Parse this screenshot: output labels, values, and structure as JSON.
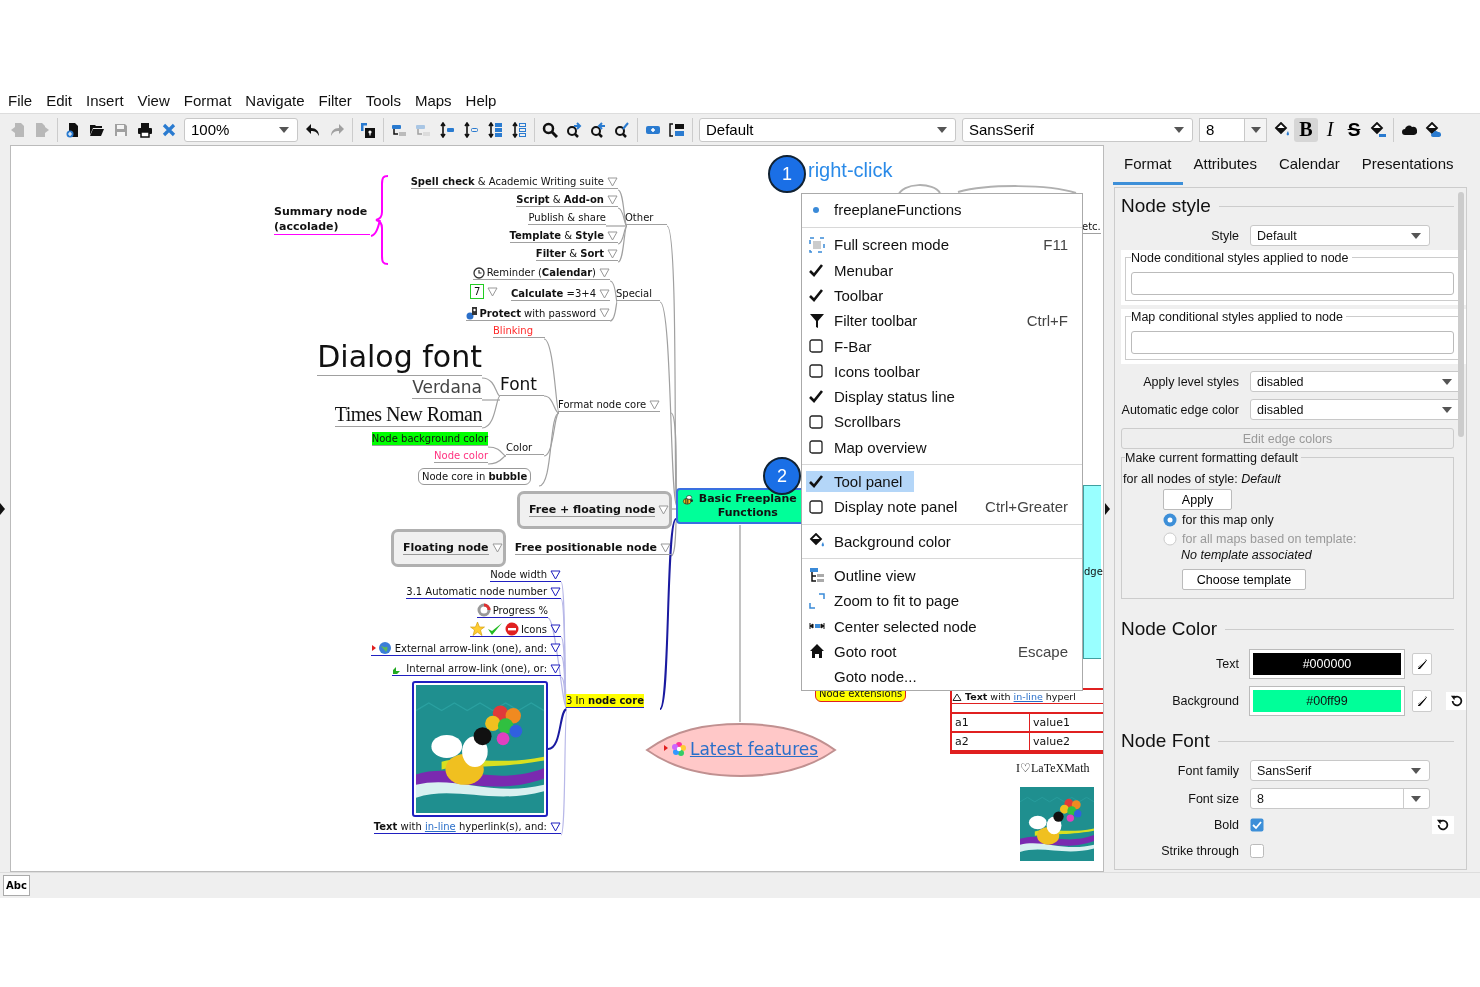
{
  "menubar": [
    "File",
    "Edit",
    "Insert",
    "View",
    "Format",
    "Navigate",
    "Filter",
    "Tools",
    "Maps",
    "Help"
  ],
  "toolbar": {
    "buttons": [
      {
        "disabled": true
      },
      {
        "disabled": true
      },
      {
        "disabled": false
      },
      {
        "disabled": false
      },
      {
        "disabled": true
      },
      {
        "disabled": false
      },
      {
        "disabled": false
      },
      {
        "disabled": false
      },
      {
        "disabled": true
      },
      {
        "disabled": false
      },
      {
        "disabled": false
      },
      {
        "disabled": true
      },
      {
        "disabled": false
      },
      {
        "disabled": false
      },
      {
        "disabled": false
      },
      {
        "disabled": false
      },
      {
        "disabled": false
      },
      {
        "disabled": false
      },
      {
        "disabled": false
      },
      {
        "disabled": false
      },
      {
        "disabled": false
      },
      {
        "disabled": false
      }
    ],
    "zoom": "100%",
    "style": "Default",
    "font_family": "SansSerif",
    "font_size": "8",
    "format_buttons": [
      {
        "pressed": false
      },
      {
        "label": "B",
        "pressed": true
      },
      {
        "label": "I",
        "pressed": false
      },
      {
        "label": "S",
        "pressed": false
      },
      {
        "pressed": false
      },
      {
        "pressed": false
      },
      {
        "pressed": false
      }
    ]
  },
  "map": {
    "nodes": [
      {
        "kind": "fork",
        "text": "Summary node (accolade)",
        "folded": false
      },
      {
        "kind": "fork",
        "text": "**Spell check** & Academic Writing suite",
        "folded": true
      },
      {
        "kind": "fork",
        "text": "**Script** & **Add-on**",
        "folded": true
      },
      {
        "kind": "fork",
        "text": "Publish & share",
        "folded": false
      },
      {
        "kind": "fork",
        "text": "**Template** & **Style**",
        "folded": true
      },
      {
        "kind": "fork",
        "text": "**Filter** & **Sort**",
        "folded": true
      },
      {
        "kind": "fork",
        "text": "Other",
        "folded": false
      },
      {
        "kind": "fork",
        "text": "Reminder (**Calendar**)",
        "folded": true
      },
      {
        "kind": "number",
        "text": "7",
        "folded": true
      },
      {
        "kind": "fork",
        "text": "**Calculate** =3+4",
        "folded": true
      },
      {
        "kind": "fork",
        "text": "**Protect** with password",
        "folded": true
      },
      {
        "kind": "fork",
        "text": "Special",
        "folded": false
      },
      {
        "kind": "fork",
        "text": "Blinking",
        "color": "#ff2a2a",
        "folded": false
      },
      {
        "kind": "fork",
        "text": "Dialog font",
        "folded": false
      },
      {
        "kind": "fork",
        "text": "Verdana",
        "folded": false
      },
      {
        "kind": "fork",
        "text": "Times New Roman",
        "folded": false
      },
      {
        "kind": "fork",
        "text": "Font",
        "folded": false
      },
      {
        "kind": "highlight",
        "text": "Node background color",
        "color": "#00ff00",
        "folded": false
      },
      {
        "kind": "fork",
        "text": "Node color",
        "color": "#ff3380",
        "folded": false
      },
      {
        "kind": "fork",
        "text": "Color",
        "folded": false
      },
      {
        "kind": "bubble",
        "text": "Node core in **bubble**",
        "folded": false
      },
      {
        "kind": "fork",
        "text": "Format node core",
        "folded": true
      },
      {
        "kind": "floating",
        "text": "Free + floating node",
        "folded": true
      },
      {
        "kind": "floating",
        "text": "Floating node",
        "folded": true
      },
      {
        "kind": "fork",
        "text": "Free positionable node",
        "folded": true
      },
      {
        "kind": "fork",
        "text": "Node width",
        "folded": true
      },
      {
        "kind": "fork",
        "text": "3.1 Automatic node number",
        "folded": true
      },
      {
        "kind": "fork",
        "text": "Progress %",
        "folded": false
      },
      {
        "kind": "fork",
        "text": "Icons",
        "folded": true
      },
      {
        "kind": "fork",
        "text": "External arrow-link (one), and:",
        "folded": true
      },
      {
        "kind": "fork",
        "text": "Internal arrow-link (one), or:",
        "folded": true
      },
      {
        "kind": "picture"
      },
      {
        "kind": "link-text",
        "text_before": "**Text**  with ",
        "link": "in-line",
        "text_after": " hyperlink(s), and:",
        "folded": true
      },
      {
        "kind": "highlight",
        "text": "3 In **node core**",
        "color": "#ffff00",
        "folded": false
      },
      {
        "kind": "root",
        "text": "Basic Freeplane Functions",
        "color": "#00ff99"
      },
      {
        "kind": "cloud",
        "text": "Latest features",
        "color": "#ffc8c8"
      },
      {
        "kind": "fork",
        "text": "etc.",
        "folded": false
      },
      {
        "kind": "box",
        "text": "dge",
        "color": "#99ffff"
      },
      {
        "kind": "bubble",
        "text": "Node extensions",
        "color": "#ffff00",
        "folded": false
      },
      {
        "kind": "table",
        "text_before": "**Text**  with ",
        "link": "in-line",
        "text_after": " hyperl",
        "rows": [
          [
            "a1",
            "value1"
          ],
          [
            "a2",
            "value2"
          ]
        ]
      },
      {
        "kind": "latex",
        "text": "I♡LaTeXMath"
      },
      {
        "kind": "picture"
      }
    ]
  },
  "callouts": [
    {
      "number": "1",
      "label": "right-click"
    },
    {
      "number": "2"
    }
  ],
  "context_menu": {
    "groups": [
      {
        "items": [
          {
            "kind": "bullet",
            "label": "freeplaneFunctions",
            "selected": false
          }
        ]
      },
      {
        "items": [
          {
            "kind": "icon",
            "label": "Full screen mode",
            "shortcut": "F11",
            "selected": false
          },
          {
            "kind": "check",
            "label": "Menubar",
            "checked": true,
            "selected": false
          },
          {
            "kind": "check",
            "label": "Toolbar",
            "checked": true,
            "selected": false
          },
          {
            "kind": "icon",
            "label": "Filter toolbar",
            "shortcut": "Ctrl+F",
            "selected": false
          },
          {
            "kind": "check",
            "label": "F-Bar",
            "checked": false,
            "selected": false
          },
          {
            "kind": "check",
            "label": "Icons toolbar",
            "checked": false,
            "selected": false
          },
          {
            "kind": "check",
            "label": "Display status line",
            "checked": true,
            "selected": false
          },
          {
            "kind": "check",
            "label": "Scrollbars",
            "checked": false,
            "selected": false
          },
          {
            "kind": "check",
            "label": "Map overview",
            "checked": false,
            "selected": false
          }
        ]
      },
      {
        "items": [
          {
            "kind": "check",
            "label": "Tool panel",
            "checked": true,
            "selected": true
          },
          {
            "kind": "check",
            "label": "Display note panel",
            "checked": false,
            "shortcut": "Ctrl+Greater",
            "selected": false
          }
        ]
      },
      {
        "items": [
          {
            "kind": "icon",
            "label": "Background color",
            "selected": false
          }
        ]
      },
      {
        "items": [
          {
            "kind": "icon",
            "label": "Outline view",
            "selected": false
          },
          {
            "kind": "icon",
            "label": "Zoom to fit to page",
            "selected": false
          },
          {
            "kind": "icon",
            "label": "Center selected node",
            "selected": false
          },
          {
            "kind": "icon",
            "label": "Goto root",
            "shortcut": "Escape",
            "selected": false
          },
          {
            "kind": "plain",
            "label": "Goto node...",
            "selected": false
          }
        ]
      }
    ]
  },
  "tool_panel": {
    "tabs": [
      {
        "label": "Format",
        "selected": true
      },
      {
        "label": "Attributes",
        "selected": false
      },
      {
        "label": "Calendar",
        "selected": false
      },
      {
        "label": "Presentations",
        "selected": false
      }
    ],
    "sections": [
      {
        "title": "Node style",
        "rows": [
          {
            "kind": "combo",
            "label": "Style",
            "value": "Default"
          },
          {
            "kind": "condition-group",
            "legend": "Node conditional styles applied to node"
          },
          {
            "kind": "condition-group",
            "legend": "Map conditional styles applied to node"
          },
          {
            "kind": "wide-combo",
            "label": "Apply level styles",
            "value": "disabled"
          },
          {
            "kind": "wide-combo",
            "label": "Automatic edge color",
            "value": "disabled"
          },
          {
            "kind": "wide-button",
            "label": "Edit edge colors",
            "disabled": true
          },
          {
            "kind": "default-group",
            "legend": "Make current formatting default",
            "text": "for all nodes of style: *Default*",
            "apply": "Apply",
            "radios": [
              {
                "label": "for this map only",
                "selected": true,
                "disabled": false
              },
              {
                "label": "for all maps based on template:",
                "selected": false,
                "disabled": true
              }
            ],
            "note": "No template associated",
            "choose": "Choose template"
          }
        ]
      },
      {
        "title": "Node Color",
        "rows": [
          {
            "kind": "color",
            "label": "Text",
            "value": "#000000",
            "color": "#000000",
            "reset": false
          },
          {
            "kind": "color",
            "label": "Background",
            "value": "#00ff99",
            "color": "#00ff99",
            "reset": true
          }
        ]
      },
      {
        "title": "Node Font",
        "rows": [
          {
            "kind": "combo",
            "label": "Font family",
            "value": "SansSerif"
          },
          {
            "kind": "spin-combo",
            "label": "Font size",
            "value": "8"
          },
          {
            "kind": "checkbox",
            "label": "Bold",
            "checked": true,
            "reset": true
          },
          {
            "kind": "checkbox",
            "label": "Strike through",
            "checked": false,
            "reset": false
          }
        ]
      }
    ]
  },
  "status_bar": {
    "label": "Abc"
  }
}
